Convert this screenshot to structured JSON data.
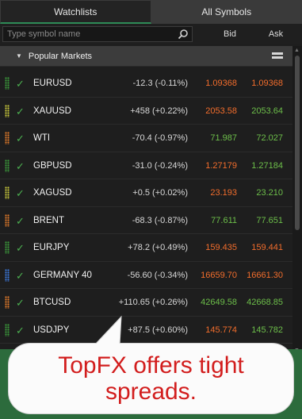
{
  "tabs": {
    "watchlists": "Watchlists",
    "all_symbols": "All Symbols"
  },
  "search": {
    "placeholder": "Type symbol name"
  },
  "columns": {
    "bid": "Bid",
    "ask": "Ask"
  },
  "section": {
    "title": "Popular Markets"
  },
  "rows": [
    {
      "symbol": "EURUSD",
      "change": "-12.3 (-0.11%)",
      "bid": "1.09368",
      "ask": "1.09368",
      "bid_dir": "down",
      "ask_dir": "down",
      "grip": "#3a9a3a"
    },
    {
      "symbol": "XAUUSD",
      "change": "+458 (+0.22%)",
      "bid": "2053.58",
      "ask": "2053.64",
      "bid_dir": "down",
      "ask_dir": "up",
      "grip": "#c8c83a"
    },
    {
      "symbol": "WTI",
      "change": "-70.4 (-0.97%)",
      "bid": "71.987",
      "ask": "72.027",
      "bid_dir": "up",
      "ask_dir": "up",
      "grip": "#e07a2a"
    },
    {
      "symbol": "GBPUSD",
      "change": "-31.0 (-0.24%)",
      "bid": "1.27179",
      "ask": "1.27184",
      "bid_dir": "down",
      "ask_dir": "up",
      "grip": "#3a9a3a"
    },
    {
      "symbol": "XAGUSD",
      "change": "+0.5 (+0.02%)",
      "bid": "23.193",
      "ask": "23.210",
      "bid_dir": "down",
      "ask_dir": "up",
      "grip": "#c8c83a"
    },
    {
      "symbol": "BRENT",
      "change": "-68.3 (-0.87%)",
      "bid": "77.611",
      "ask": "77.651",
      "bid_dir": "up",
      "ask_dir": "up",
      "grip": "#e07a2a"
    },
    {
      "symbol": "EURJPY",
      "change": "+78.2 (+0.49%)",
      "bid": "159.435",
      "ask": "159.441",
      "bid_dir": "down",
      "ask_dir": "down",
      "grip": "#3a9a3a"
    },
    {
      "symbol": "GERMANY 40",
      "change": "-56.60 (-0.34%)",
      "bid": "16659.70",
      "ask": "16661.30",
      "bid_dir": "down",
      "ask_dir": "down",
      "grip": "#3a7adf"
    },
    {
      "symbol": "BTCUSD",
      "change": "+110.65 (+0.26%)",
      "bid": "42649.58",
      "ask": "42668.85",
      "bid_dir": "up",
      "ask_dir": "up",
      "grip": "#e07a2a"
    },
    {
      "symbol": "USDJPY",
      "change": "+87.5 (+0.60%)",
      "bid": "145.774",
      "ask": "145.782",
      "bid_dir": "down",
      "ask_dir": "up",
      "grip": "#3a9a3a"
    }
  ],
  "callout": {
    "text": "TopFX offers tight spreads."
  },
  "colors": {
    "up": "#6dbf4a",
    "down": "#f26d2c",
    "callout_text": "#d21d1d"
  }
}
